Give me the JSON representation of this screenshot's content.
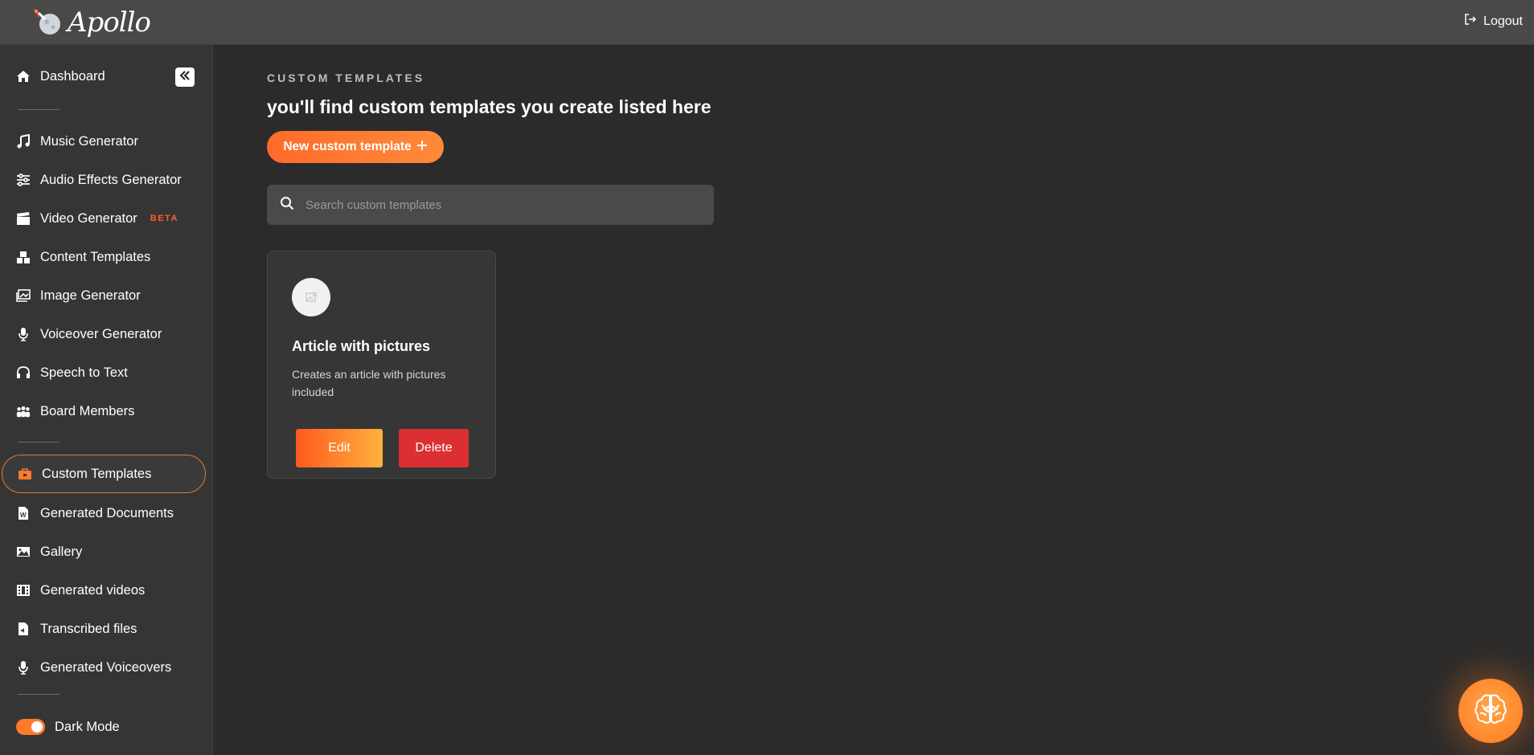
{
  "app": {
    "name": "Apollo"
  },
  "header": {
    "logout_label": "Logout"
  },
  "sidebar": {
    "dashboard": "Dashboard",
    "tools": [
      {
        "label": "Music Generator",
        "icon": "music-icon"
      },
      {
        "label": "Audio Effects Generator",
        "icon": "sliders-icon"
      },
      {
        "label": "Video Generator",
        "icon": "clapperboard-icon",
        "badge": "BETA"
      },
      {
        "label": "Content Templates",
        "icon": "templates-icon"
      },
      {
        "label": "Image Generator",
        "icon": "image-icon"
      },
      {
        "label": "Voiceover Generator",
        "icon": "microphone-icon"
      },
      {
        "label": "Speech to Text",
        "icon": "headset-icon"
      },
      {
        "label": "Board Members",
        "icon": "users-icon"
      }
    ],
    "library": [
      {
        "label": "Custom Templates",
        "icon": "toolbox-icon",
        "active": true
      },
      {
        "label": "Generated Documents",
        "icon": "document-icon"
      },
      {
        "label": "Gallery",
        "icon": "gallery-icon"
      },
      {
        "label": "Generated videos",
        "icon": "film-icon"
      },
      {
        "label": "Transcribed files",
        "icon": "file-audio-icon"
      },
      {
        "label": "Generated Voiceovers",
        "icon": "microphone-icon"
      }
    ],
    "dark_mode_label": "Dark Mode",
    "dark_mode_on": true
  },
  "main": {
    "eyebrow": "CUSTOM TEMPLATES",
    "headline": "you'll find custom templates you create listed here",
    "new_button": "New custom template",
    "search_placeholder": "Search custom templates",
    "cards": [
      {
        "title": "Article with pictures",
        "description": "Creates an article with pictures included",
        "edit_label": "Edit",
        "delete_label": "Delete"
      }
    ]
  },
  "colors": {
    "accent": "#ff7a2c",
    "danger": "#dc2f34",
    "sidebar_bg": "#353535",
    "main_bg": "#2b2b2b"
  }
}
